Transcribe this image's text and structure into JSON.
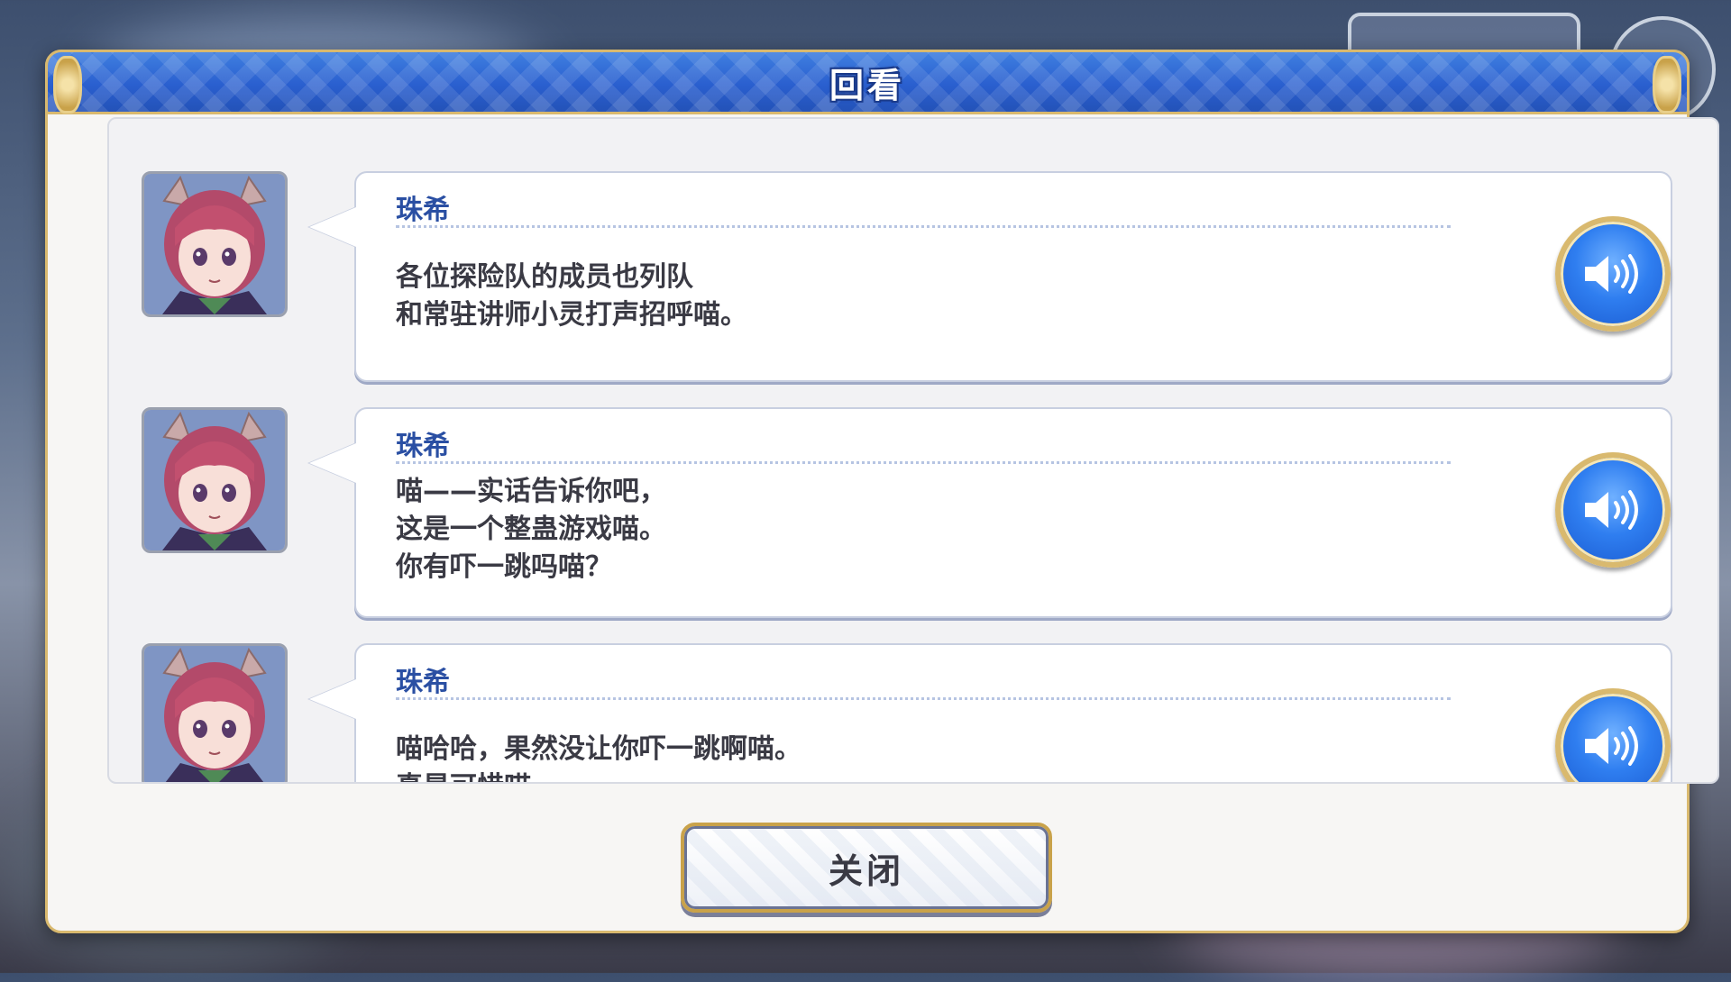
{
  "dialog": {
    "title": "回看",
    "close_label": "关闭"
  },
  "entries": [
    {
      "speaker": "珠希",
      "lines": [
        "各位探险队的成员也列队",
        "和常驻讲师小灵打声招呼喵。"
      ]
    },
    {
      "speaker": "珠希",
      "lines": [
        "喵——实话告诉你吧，",
        "这是一个整蛊游戏喵。",
        "你有吓一跳吗喵？"
      ]
    },
    {
      "speaker": "珠希",
      "lines": [
        "喵哈哈，果然没让你吓一跳啊喵。",
        "真是可惜喵。"
      ]
    }
  ],
  "scroll": {
    "position_fraction": 0.92
  },
  "colors": {
    "header_blue": "#2a5fcf",
    "gold_frame": "#d9b96e",
    "speaker_name": "#2a4fa3",
    "voice_button": "#2f7ef0"
  },
  "icons": {
    "voice": "speaker-volume-icon",
    "avatar": "character-portrait"
  }
}
